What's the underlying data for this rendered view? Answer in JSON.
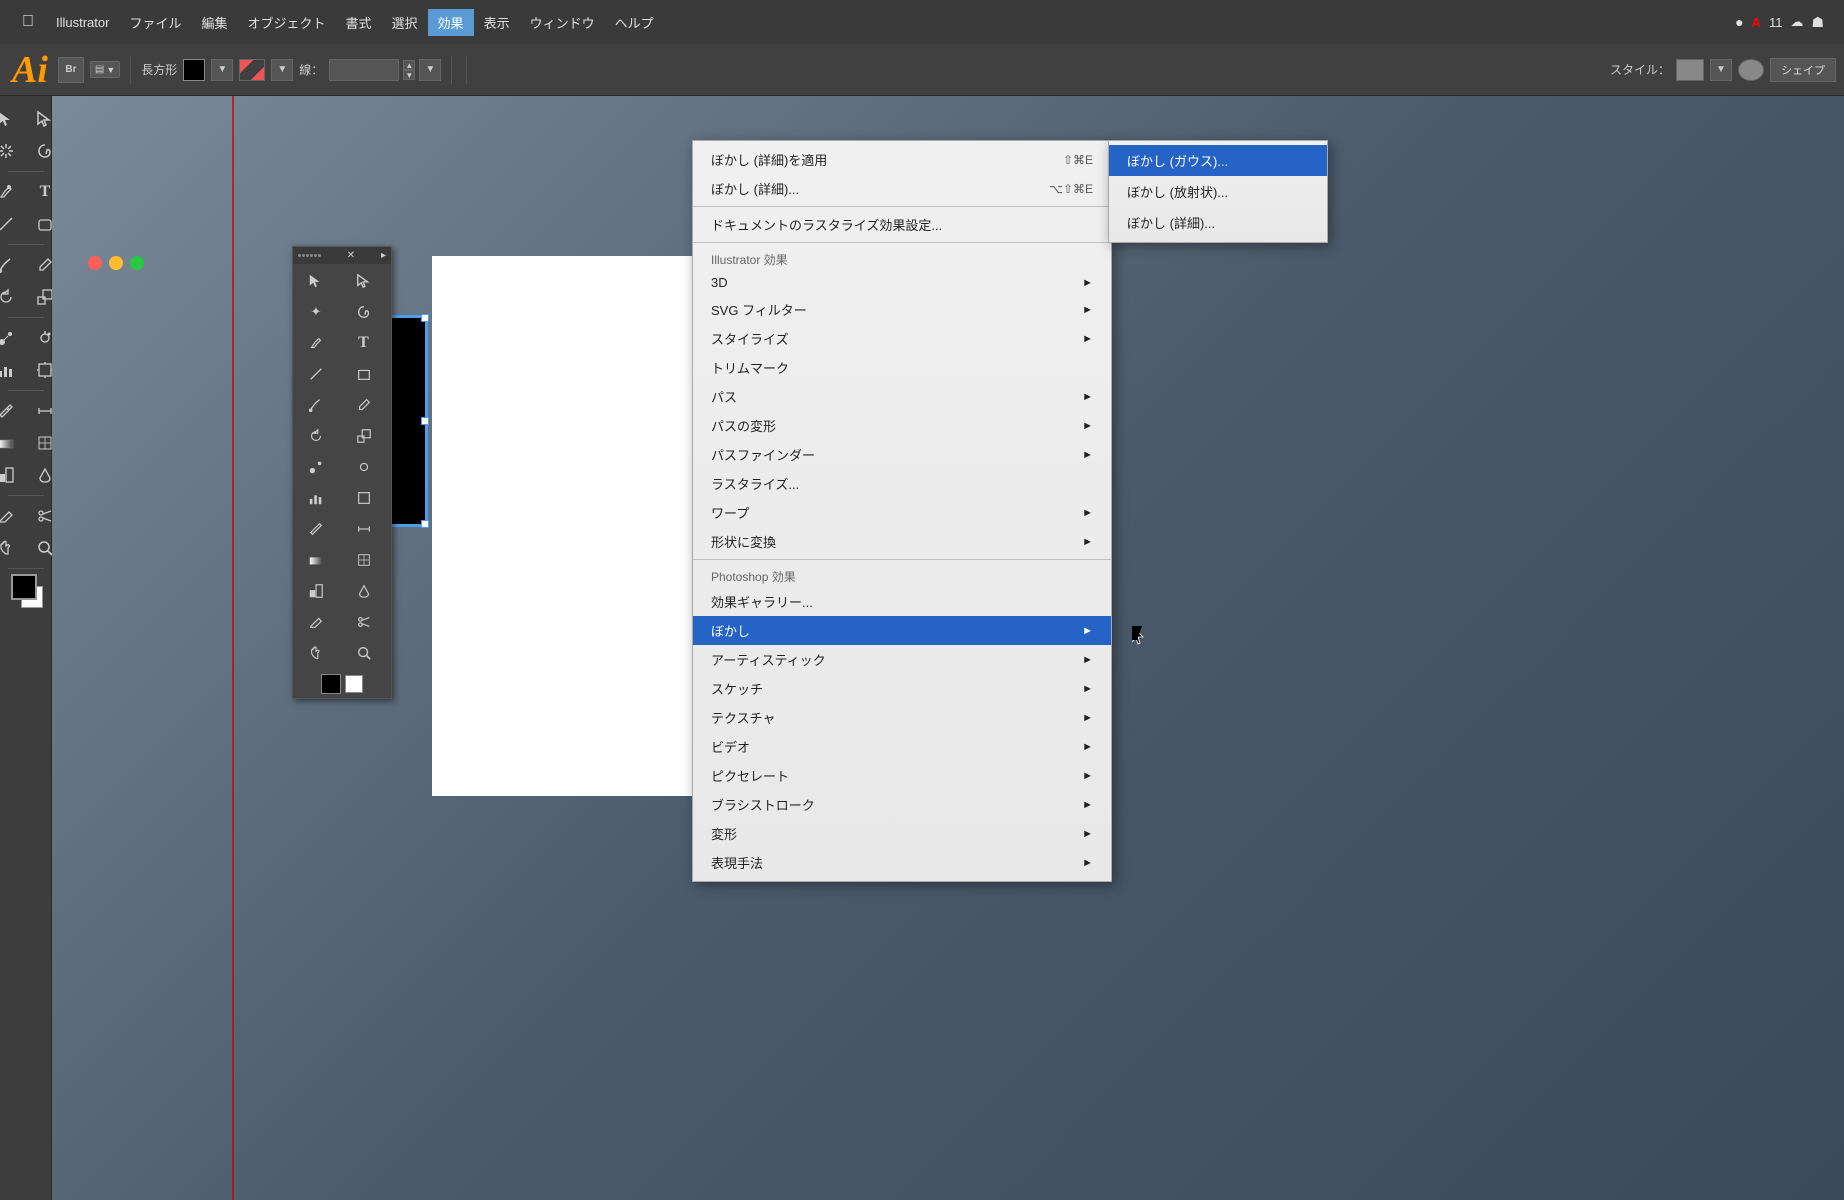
{
  "app": {
    "name": "Illustrator",
    "logo": "Ai"
  },
  "menubar": {
    "apple": "",
    "items": [
      {
        "label": "Illustrator",
        "active": false
      },
      {
        "label": "ファイル",
        "active": false
      },
      {
        "label": "編集",
        "active": false
      },
      {
        "label": "オブジェクト",
        "active": false
      },
      {
        "label": "書式",
        "active": false
      },
      {
        "label": "選択",
        "active": false
      },
      {
        "label": "効果",
        "active": true
      },
      {
        "label": "表示",
        "active": false
      },
      {
        "label": "ウィンドウ",
        "active": false
      },
      {
        "label": "ヘルプ",
        "active": false
      }
    ],
    "right": {
      "version": "11",
      "creative_cloud": "CC"
    }
  },
  "toolbar": {
    "shape_label": "長方形",
    "stroke_label": "線：",
    "style_label": "スタイル：",
    "shape_btn": "シェイプ"
  },
  "dropdown": {
    "items": [
      {
        "label": "ぼかし (詳細)を適用",
        "shortcut": "⇧⌘E",
        "submenu": false,
        "disabled": false
      },
      {
        "label": "ぼかし (詳細)...",
        "shortcut": "⌥⇧⌘E",
        "submenu": false,
        "disabled": false
      },
      {
        "separator": true
      },
      {
        "label": "ドキュメントのラスタライズ効果設定...",
        "submenu": false,
        "disabled": false
      },
      {
        "separator": true
      },
      {
        "section": "Illustrator 効果"
      },
      {
        "label": "3D",
        "submenu": true,
        "disabled": false
      },
      {
        "label": "SVG フィルター",
        "submenu": true,
        "disabled": false
      },
      {
        "label": "スタイライズ",
        "submenu": true,
        "disabled": false
      },
      {
        "label": "トリムマーク",
        "submenu": false,
        "disabled": false
      },
      {
        "label": "パス",
        "submenu": true,
        "disabled": false
      },
      {
        "label": "パスの変形",
        "submenu": true,
        "disabled": false
      },
      {
        "label": "パスファインダー",
        "submenu": true,
        "disabled": false
      },
      {
        "label": "ラスタライズ...",
        "submenu": false,
        "disabled": false
      },
      {
        "label": "ワープ",
        "submenu": true,
        "disabled": false
      },
      {
        "label": "形状に変換",
        "submenu": true,
        "disabled": false
      },
      {
        "separator": true
      },
      {
        "section": "Photoshop 効果"
      },
      {
        "label": "効果ギャラリー...",
        "submenu": false,
        "disabled": false
      },
      {
        "label": "ぼかし",
        "submenu": true,
        "highlighted": true,
        "disabled": false
      },
      {
        "label": "アーティスティック",
        "submenu": true,
        "disabled": false
      },
      {
        "label": "スケッチ",
        "submenu": true,
        "disabled": false
      },
      {
        "label": "テクスチャ",
        "submenu": true,
        "disabled": false
      },
      {
        "label": "ビデオ",
        "submenu": true,
        "disabled": false
      },
      {
        "label": "ピクセレート",
        "submenu": true,
        "disabled": false
      },
      {
        "label": "ブラシストローク",
        "submenu": true,
        "disabled": false
      },
      {
        "label": "変形",
        "submenu": true,
        "disabled": false
      },
      {
        "label": "表現手法",
        "submenu": true,
        "disabled": false
      }
    ]
  },
  "submenu_bokashi": {
    "items": [
      {
        "label": "ぼかし (ガウス)...",
        "highlighted": true
      },
      {
        "label": "ぼかし (放射状)...",
        "highlighted": false
      },
      {
        "label": "ぼかし (詳細)...",
        "highlighted": false
      }
    ]
  },
  "tools": {
    "left_panel": [
      "selection",
      "direct-selection",
      "magic-wand",
      "lasso",
      "pen",
      "type",
      "line",
      "ellipse",
      "paintbrush",
      "pencil",
      "rotate",
      "scale",
      "blend",
      "symbol-sprayer",
      "column-graph",
      "artboard",
      "eyedropper",
      "measure",
      "gradient",
      "mesh",
      "live-paint",
      "live-paint-bucket",
      "eraser",
      "scissors",
      "hand",
      "zoom"
    ]
  }
}
